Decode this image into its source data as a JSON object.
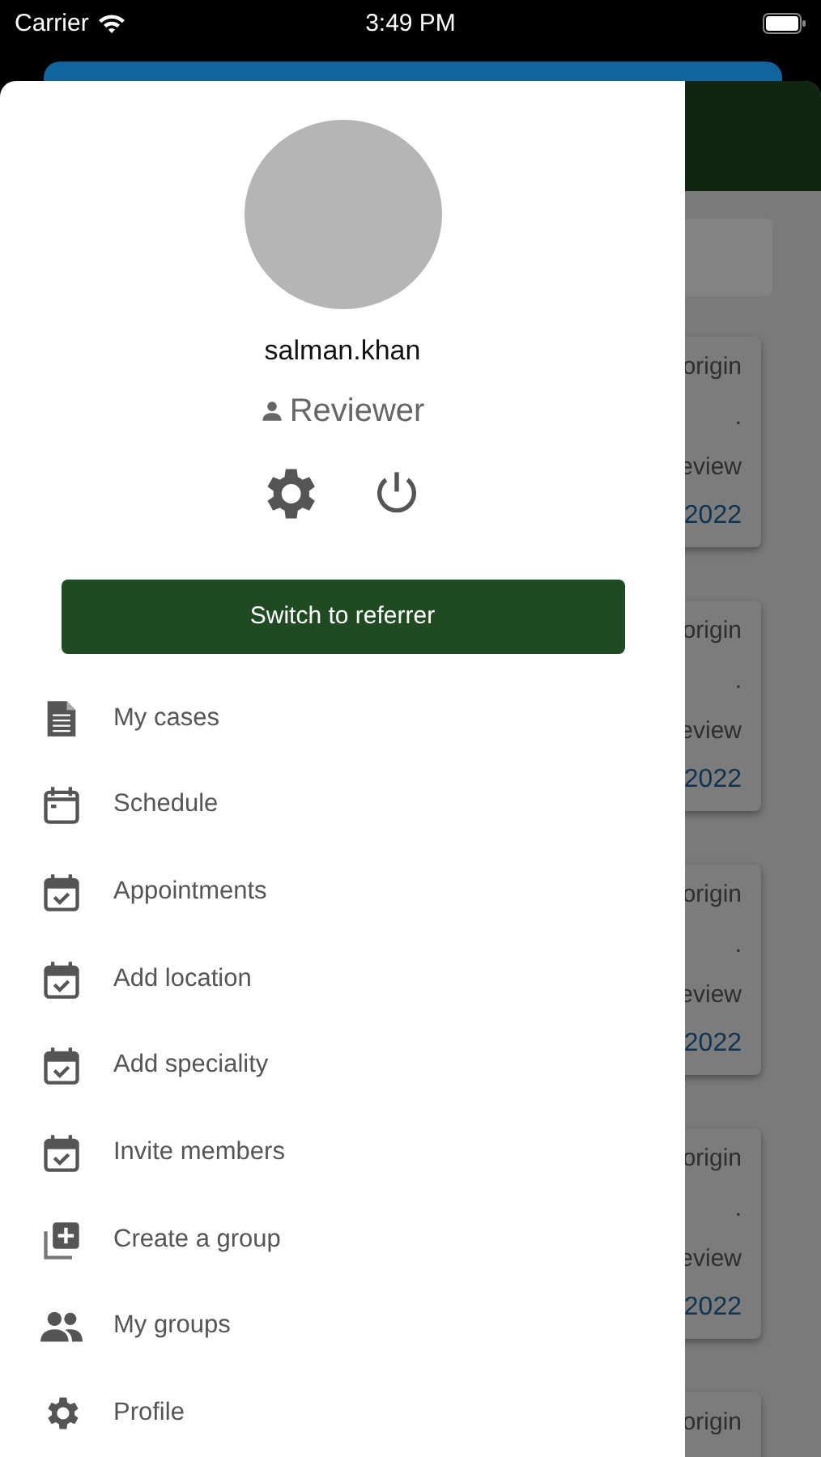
{
  "status_bar": {
    "carrier": "Carrier",
    "time": "3:49 PM"
  },
  "background_cards": [
    {
      "line_1": "origin",
      "line_2": ".",
      "line_3": "eview",
      "line_4": "2022"
    },
    {
      "line_1": "origin",
      "line_2": ".",
      "line_3": "eview",
      "line_4": "2022"
    },
    {
      "line_1": "origin",
      "line_2": ".",
      "line_3": "eview",
      "line_4": "2022"
    },
    {
      "line_1": "origin",
      "line_2": ".",
      "line_3": "eview",
      "line_4": "2022"
    },
    {
      "line_1": "origin"
    }
  ],
  "drawer": {
    "username": "salman.khan",
    "role": "Reviewer",
    "switch_button": "Switch to referrer",
    "menu": [
      {
        "kind": "document",
        "label": "My cases"
      },
      {
        "kind": "calendar",
        "label": "Schedule"
      },
      {
        "kind": "calendar-check",
        "label": "Appointments"
      },
      {
        "kind": "calendar-check",
        "label": "Add location"
      },
      {
        "kind": "calendar-check",
        "label": "Add speciality"
      },
      {
        "kind": "calendar-check",
        "label": "Invite members"
      },
      {
        "kind": "add-box",
        "label": "Create a group"
      },
      {
        "kind": "people",
        "label": "My groups"
      },
      {
        "kind": "gear",
        "label": "Profile"
      }
    ]
  }
}
